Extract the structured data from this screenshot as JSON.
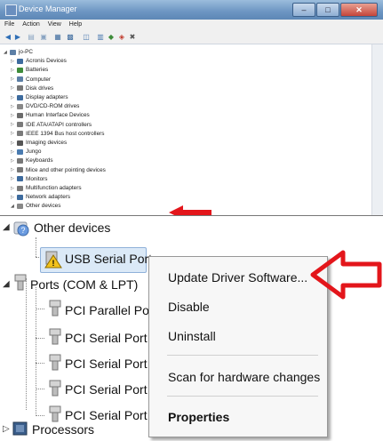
{
  "window": {
    "title": "Device Manager",
    "minimize_glyph": "–",
    "maximize_glyph": "□",
    "close_glyph": "✕"
  },
  "menubar": [
    "File",
    "Action",
    "View",
    "Help"
  ],
  "dm_tree": [
    {
      "label": "jo-PC",
      "expander": "◢",
      "icon": "computer-icon",
      "color": "#5c7fa6"
    },
    {
      "label": "Acronis Devices",
      "expander": "▷",
      "icon": "device-icon",
      "color": "#3d6b9e"
    },
    {
      "label": "Batteries",
      "expander": "▷",
      "icon": "battery-icon",
      "color": "#3e8c3a"
    },
    {
      "label": "Computer",
      "expander": "▷",
      "icon": "computer-icon",
      "color": "#5c7fa6"
    },
    {
      "label": "Disk drives",
      "expander": "▷",
      "icon": "disk-icon",
      "color": "#777777"
    },
    {
      "label": "Display adapters",
      "expander": "▷",
      "icon": "display-icon",
      "color": "#3d6b9e"
    },
    {
      "label": "DVD/CD-ROM drives",
      "expander": "▷",
      "icon": "dvd-icon",
      "color": "#888888"
    },
    {
      "label": "Human Interface Devices",
      "expander": "▷",
      "icon": "hid-icon",
      "color": "#6b6b6b"
    },
    {
      "label": "IDE ATA/ATAPI controllers",
      "expander": "▷",
      "icon": "ide-icon",
      "color": "#7a7a7a"
    },
    {
      "label": "IEEE 1394 Bus host controllers",
      "expander": "▷",
      "icon": "bus-icon",
      "color": "#7a7a7a"
    },
    {
      "label": "Imaging devices",
      "expander": "▷",
      "icon": "camera-icon",
      "color": "#555555"
    },
    {
      "label": "Jungo",
      "expander": "▷",
      "icon": "device-icon",
      "color": "#4a7bb0"
    },
    {
      "label": "Keyboards",
      "expander": "▷",
      "icon": "keyboard-icon",
      "color": "#777777"
    },
    {
      "label": "Mice and other pointing devices",
      "expander": "▷",
      "icon": "mouse-icon",
      "color": "#777777"
    },
    {
      "label": "Monitors",
      "expander": "▷",
      "icon": "monitor-icon",
      "color": "#3d6b9e"
    },
    {
      "label": "Multifunction adapters",
      "expander": "▷",
      "icon": "adapter-icon",
      "color": "#7a7a7a"
    },
    {
      "label": "Network adapters",
      "expander": "▷",
      "icon": "network-icon",
      "color": "#3d6b9e"
    },
    {
      "label": "Other devices",
      "expander": "◢",
      "icon": "unknown-device-icon",
      "color": "#888888"
    }
  ],
  "zoom_tree": {
    "other_devices": "Other devices",
    "usb_serial_port": "USB Serial Port",
    "ports": "Ports (COM & LPT)",
    "pci_parallel_port": "PCI Parallel Port",
    "pci_serial_ports": [
      "PCI Serial Port",
      "PCI Serial Port",
      "PCI Serial Port",
      "PCI Serial Port"
    ],
    "processors": "Processors"
  },
  "context_menu": {
    "update_driver": "Update Driver Software...",
    "disable": "Disable",
    "uninstall": "Uninstall",
    "scan": "Scan for hardware changes",
    "properties": "Properties"
  },
  "colors": {
    "arrow_red": "#e3161b",
    "highlight": "#dbe9f7",
    "warning": "#f2c21b"
  }
}
